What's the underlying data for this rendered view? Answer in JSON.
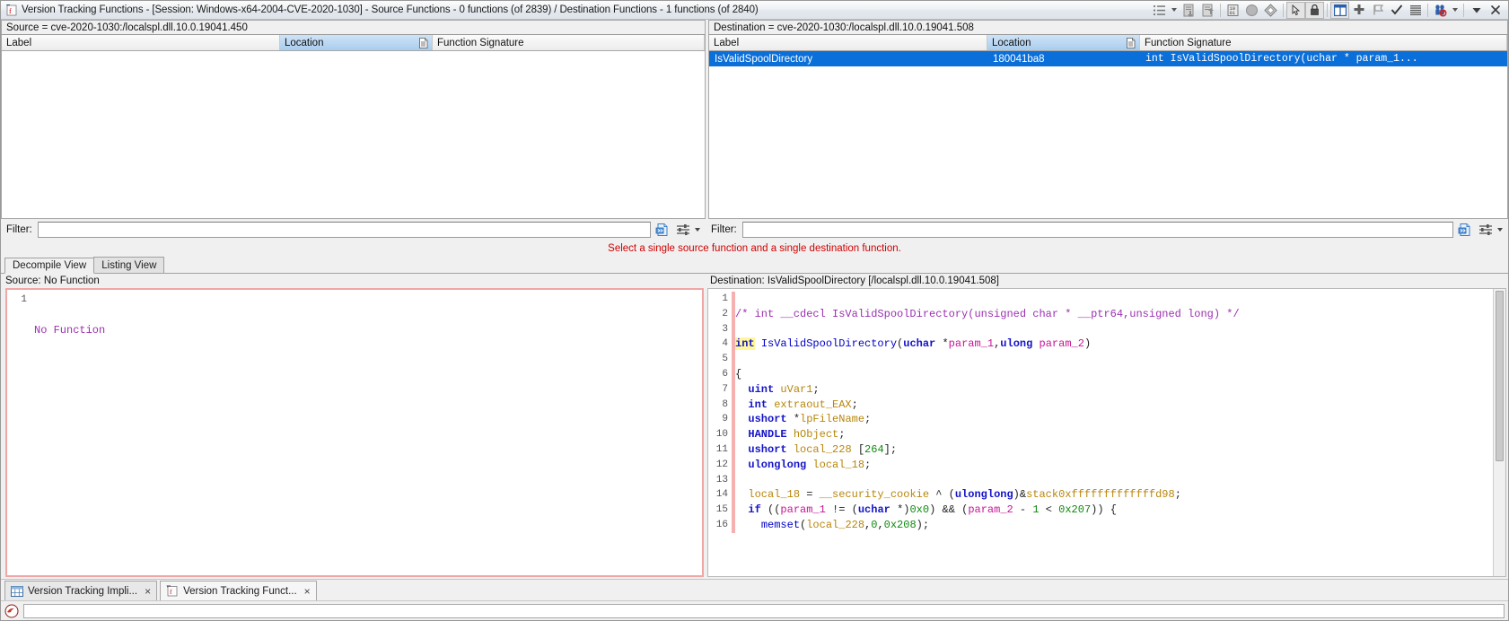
{
  "window": {
    "title": "Version Tracking Functions - [Session: Windows-x64-2004-CVE-2020-1030] - Source Functions - 0 functions (of 2839) / Destination Functions - 1 functions (of 2840)",
    "icon": "ghidra-vt-icon"
  },
  "toolbar": {
    "items": [
      {
        "name": "list-options-icon",
        "label": "List Options"
      },
      {
        "name": "list-options-caret-icon",
        "label": "List Options Menu"
      },
      {
        "name": "apply-markup-icon",
        "label": "Apply Markup"
      },
      {
        "name": "markup-items-icon",
        "label": "Markup Items"
      },
      {
        "name": "binary-compare-icon",
        "label": "Binary Compare"
      },
      {
        "name": "circle-icon",
        "label": "Status"
      },
      {
        "name": "diamond-icon",
        "label": "Diff"
      },
      {
        "name": "cursor-select-icon",
        "label": "Select Cursor"
      },
      {
        "name": "lock-icon",
        "label": "Lock"
      },
      {
        "name": "dual-panel-icon",
        "label": "Dual Panel View"
      },
      {
        "name": "add-plus-icon",
        "label": "Add"
      },
      {
        "name": "flag-icon",
        "label": "Flag"
      },
      {
        "name": "check-icon",
        "label": "Accept"
      },
      {
        "name": "lines-icon",
        "label": "Details"
      },
      {
        "name": "filter-people-icon",
        "label": "Filter"
      },
      {
        "name": "filter-caret-icon",
        "label": "Filter Menu"
      },
      {
        "name": "dropdown-caret-icon",
        "label": "More"
      },
      {
        "name": "close-icon",
        "label": "Close"
      }
    ]
  },
  "source_panel": {
    "header": "Source = cve-2020-1030:/localspl.dll.10.0.19041.450",
    "columns": [
      "Label",
      "Location",
      "Function Signature"
    ],
    "sorted_column": "Location",
    "rows": []
  },
  "destination_panel": {
    "header": "Destination = cve-2020-1030:/localspl.dll.10.0.19041.508",
    "columns": [
      "Label",
      "Location",
      "Function Signature"
    ],
    "sorted_column": "Location",
    "rows": [
      {
        "label": "IsValidSpoolDirectory",
        "location": "180041ba8",
        "signature": "int IsValidSpoolDirectory(uchar * param_1...",
        "selected": true
      }
    ]
  },
  "filters": {
    "source": {
      "label": "Filter:",
      "value": "",
      "placeholder": ""
    },
    "destination": {
      "label": "Filter:",
      "value": "",
      "placeholder": ""
    }
  },
  "status_message": "Select a single source function and a single destination function.",
  "view_tabs": [
    {
      "label": "Decompile View",
      "active": true
    },
    {
      "label": "Listing View",
      "active": false
    }
  ],
  "decompile": {
    "source": {
      "header": "Source: No Function",
      "lines": [
        {
          "num": "1",
          "tokens": [
            {
              "t": "No Function",
              "c": "c-cmt"
            }
          ]
        }
      ]
    },
    "destination": {
      "header": "Destination: IsValidSpoolDirectory  [/localspl.dll.10.0.19041.508]",
      "lines": [
        {
          "num": "1",
          "tokens": []
        },
        {
          "num": "2",
          "tokens": [
            {
              "t": "/* int __cdecl IsValidSpoolDirectory(unsigned char * __ptr64,unsigned long) */",
              "c": "c-cmt"
            }
          ]
        },
        {
          "num": "3",
          "tokens": []
        },
        {
          "num": "4",
          "tokens": [
            {
              "t": "int",
              "c": "c-type hl-cursor",
              "cursor": true
            },
            {
              "t": " ",
              "c": "c-pln"
            },
            {
              "t": "IsValidSpoolDirectory",
              "c": "c-fn"
            },
            {
              "t": "(",
              "c": "c-pln"
            },
            {
              "t": "uchar",
              "c": "c-type"
            },
            {
              "t": " *",
              "c": "c-pln"
            },
            {
              "t": "param_1",
              "c": "c-parm"
            },
            {
              "t": ",",
              "c": "c-pln"
            },
            {
              "t": "ulong",
              "c": "c-type"
            },
            {
              "t": " ",
              "c": "c-pln"
            },
            {
              "t": "param_2",
              "c": "c-parm"
            },
            {
              "t": ")",
              "c": "c-pln"
            }
          ]
        },
        {
          "num": "5",
          "tokens": []
        },
        {
          "num": "6",
          "tokens": [
            {
              "t": "{",
              "c": "c-pln"
            }
          ]
        },
        {
          "num": "7",
          "tokens": [
            {
              "t": "  ",
              "c": "c-pln"
            },
            {
              "t": "uint",
              "c": "c-type"
            },
            {
              "t": " ",
              "c": "c-pln"
            },
            {
              "t": "uVar1",
              "c": "c-var"
            },
            {
              "t": ";",
              "c": "c-pln"
            }
          ]
        },
        {
          "num": "8",
          "tokens": [
            {
              "t": "  ",
              "c": "c-pln"
            },
            {
              "t": "int",
              "c": "c-type"
            },
            {
              "t": " ",
              "c": "c-pln"
            },
            {
              "t": "extraout_EAX",
              "c": "c-var"
            },
            {
              "t": ";",
              "c": "c-pln"
            }
          ]
        },
        {
          "num": "9",
          "tokens": [
            {
              "t": "  ",
              "c": "c-pln"
            },
            {
              "t": "ushort",
              "c": "c-type"
            },
            {
              "t": " *",
              "c": "c-pln"
            },
            {
              "t": "lpFileName",
              "c": "c-var"
            },
            {
              "t": ";",
              "c": "c-pln"
            }
          ]
        },
        {
          "num": "10",
          "tokens": [
            {
              "t": "  ",
              "c": "c-pln"
            },
            {
              "t": "HANDLE",
              "c": "c-type"
            },
            {
              "t": " ",
              "c": "c-pln"
            },
            {
              "t": "hObject",
              "c": "c-var"
            },
            {
              "t": ";",
              "c": "c-pln"
            }
          ]
        },
        {
          "num": "11",
          "tokens": [
            {
              "t": "  ",
              "c": "c-pln"
            },
            {
              "t": "ushort",
              "c": "c-type"
            },
            {
              "t": " ",
              "c": "c-pln"
            },
            {
              "t": "local_228",
              "c": "c-var"
            },
            {
              "t": " [",
              "c": "c-pln"
            },
            {
              "t": "264",
              "c": "c-num"
            },
            {
              "t": "];",
              "c": "c-pln"
            }
          ]
        },
        {
          "num": "12",
          "tokens": [
            {
              "t": "  ",
              "c": "c-pln"
            },
            {
              "t": "ulonglong",
              "c": "c-type"
            },
            {
              "t": " ",
              "c": "c-pln"
            },
            {
              "t": "local_18",
              "c": "c-var"
            },
            {
              "t": ";",
              "c": "c-pln"
            }
          ]
        },
        {
          "num": "13",
          "tokens": []
        },
        {
          "num": "14",
          "tokens": [
            {
              "t": "  ",
              "c": "c-pln"
            },
            {
              "t": "local_18",
              "c": "c-var"
            },
            {
              "t": " = ",
              "c": "c-pln"
            },
            {
              "t": "__security_cookie",
              "c": "c-glob"
            },
            {
              "t": " ^ (",
              "c": "c-pln"
            },
            {
              "t": "ulonglong",
              "c": "c-type"
            },
            {
              "t": ")&",
              "c": "c-pln"
            },
            {
              "t": "stack0xfffffffffffffd98",
              "c": "c-glob"
            },
            {
              "t": ";",
              "c": "c-pln"
            }
          ]
        },
        {
          "num": "15",
          "tokens": [
            {
              "t": "  ",
              "c": "c-pln"
            },
            {
              "t": "if",
              "c": "c-kw"
            },
            {
              "t": " ((",
              "c": "c-pln"
            },
            {
              "t": "param_1",
              "c": "c-parm"
            },
            {
              "t": " != (",
              "c": "c-pln"
            },
            {
              "t": "uchar",
              "c": "c-type"
            },
            {
              "t": " *)",
              "c": "c-pln"
            },
            {
              "t": "0x0",
              "c": "c-num"
            },
            {
              "t": ") && (",
              "c": "c-pln"
            },
            {
              "t": "param_2",
              "c": "c-parm"
            },
            {
              "t": " - ",
              "c": "c-pln"
            },
            {
              "t": "1",
              "c": "c-num"
            },
            {
              "t": " < ",
              "c": "c-pln"
            },
            {
              "t": "0x207",
              "c": "c-num"
            },
            {
              "t": ")) {",
              "c": "c-pln"
            }
          ]
        },
        {
          "num": "16",
          "tokens": [
            {
              "t": "    ",
              "c": "c-pln"
            },
            {
              "t": "memset",
              "c": "c-fn"
            },
            {
              "t": "(",
              "c": "c-pln"
            },
            {
              "t": "local_228",
              "c": "c-var"
            },
            {
              "t": ",",
              "c": "c-pln"
            },
            {
              "t": "0",
              "c": "c-num"
            },
            {
              "t": ",",
              "c": "c-pln"
            },
            {
              "t": "0x208",
              "c": "c-num"
            },
            {
              "t": ");",
              "c": "c-pln"
            }
          ]
        }
      ]
    }
  },
  "window_tabs": [
    {
      "label": "Version Tracking Impli...",
      "icon": "table-icon",
      "active": false,
      "close": "×"
    },
    {
      "label": "Version Tracking Funct...",
      "icon": "ghidra-vt-icon",
      "active": true,
      "close": "×"
    }
  ],
  "statusbar": {
    "icon": "ghidra-dragon-icon",
    "message": ""
  },
  "colors": {
    "selection_blue": "#0a6fd8",
    "sorted_header": "#a8cdee",
    "status_red": "#d00000",
    "source_border_pink": "#f0a6a6",
    "cursor_highlight": "#fff79a"
  }
}
